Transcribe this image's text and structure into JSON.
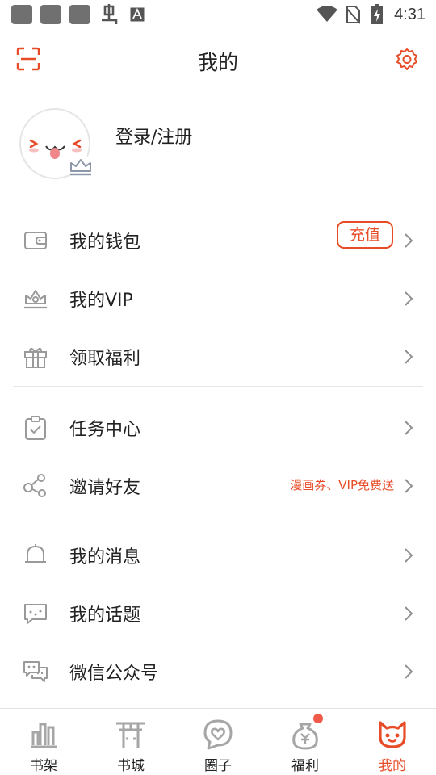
{
  "status_bar": {
    "time": "4:31",
    "icons": [
      "notification-square-icon",
      "notification-square-icon",
      "notification-square-icon",
      "bug-icon",
      "font-a-icon",
      "wifi-icon",
      "no-sim-icon",
      "battery-charging-icon"
    ]
  },
  "header": {
    "title": "我的",
    "left_icon": "scan-icon",
    "right_icon": "gear-icon"
  },
  "profile": {
    "login_label": "登录/注册",
    "avatar_icon": "avatar-face-icon",
    "badge_icon": "crown-icon"
  },
  "menu": {
    "wallet": {
      "label": "我的钱包",
      "action": "充值",
      "icon": "wallet-icon"
    },
    "vip": {
      "label": "我的VIP",
      "icon": "crown-icon"
    },
    "benefits": {
      "label": "领取福利",
      "icon": "gift-icon"
    },
    "tasks": {
      "label": "任务中心",
      "icon": "clipboard-check-icon"
    },
    "invite": {
      "label": "邀请好友",
      "promo": "漫画券、VIP免费送",
      "icon": "share-icon"
    },
    "messages": {
      "label": "我的消息",
      "icon": "bell-icon"
    },
    "topics": {
      "label": "我的话题",
      "icon": "chat-bubble-icon"
    },
    "wechat": {
      "label": "微信公众号",
      "icon": "wechat-icon"
    }
  },
  "bottom_nav": {
    "items": [
      {
        "label": "书架",
        "icon": "bookshelf-icon"
      },
      {
        "label": "书城",
        "icon": "torii-gate-icon"
      },
      {
        "label": "圈子",
        "icon": "heart-chat-icon"
      },
      {
        "label": "福利",
        "icon": "money-bag-icon"
      },
      {
        "label": "我的",
        "icon": "cat-face-icon",
        "active": true
      }
    ]
  },
  "colors": {
    "accent": "#e84b27",
    "icon_gray": "#9a9a9a",
    "text": "#222222",
    "divider": "#e6e6e6",
    "badge": "#f05a4a"
  }
}
